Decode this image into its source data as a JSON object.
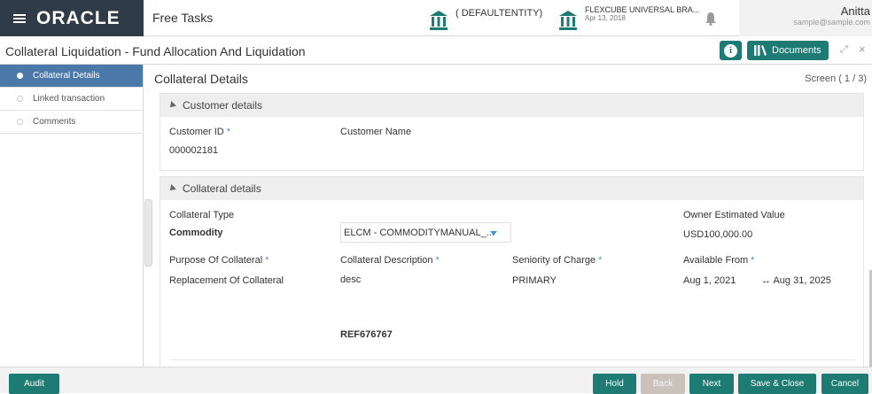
{
  "header": {
    "logo": "ORACLE",
    "free_tasks": "Free Tasks",
    "entity": "( DEFAULTENTITY)",
    "branch_name": "FLEXCUBE UNIVERSAL BRA...",
    "branch_date": "Apr 13, 2018",
    "user_name": "Anitta",
    "user_email": "sample@sample.com"
  },
  "titlebar": {
    "title": "Collateral Liquidation - Fund Allocation And Liquidation",
    "documents_label": "Documents",
    "info_glyph": "i",
    "minimize_glyph": "⤢",
    "close_glyph": "×"
  },
  "nav": {
    "items": [
      {
        "label": "Collateral Details",
        "active": true
      },
      {
        "label": "Linked transaction",
        "active": false
      },
      {
        "label": "Comments",
        "active": false
      }
    ]
  },
  "main": {
    "heading": "Collateral Details",
    "screen_indicator": "Screen ( 1 / 3)",
    "customer": {
      "section_title": "Customer details",
      "customer_id_label": "Customer ID",
      "customer_id_value": "000002181",
      "customer_name_label": "Customer Name",
      "required_mark": "*"
    },
    "collateral": {
      "section_title": "Collateral details",
      "type_label": "Collateral Type",
      "type_value": "Commodity",
      "type_select_value": "ELCM - COMMODITYMANUAL_...",
      "owner_value_label": "Owner Estimated Value",
      "owner_value": "USD100,000.00",
      "purpose_label": "Purpose Of Collateral",
      "purpose_value": "Replacement Of Collateral",
      "description_label": "Collateral Description",
      "description_value": "desc",
      "seniority_label": "Seniority of Charge",
      "seniority_value": "PRIMARY",
      "available_from_label": "Available From",
      "available_from": "Aug 1, 2021",
      "available_to": "↔ Aug 31, 2025",
      "reference_value": "REF676767"
    }
  },
  "footer": {
    "audit": "Audit",
    "hold": "Hold",
    "back": "Back",
    "next": "Next",
    "save_close": "Save & Close",
    "cancel": "Cancel"
  },
  "colors": {
    "brand_dark": "#2f3b47",
    "teal": "#1d7b74",
    "nav_active": "#4a79a9",
    "required": "#4a90d9"
  }
}
